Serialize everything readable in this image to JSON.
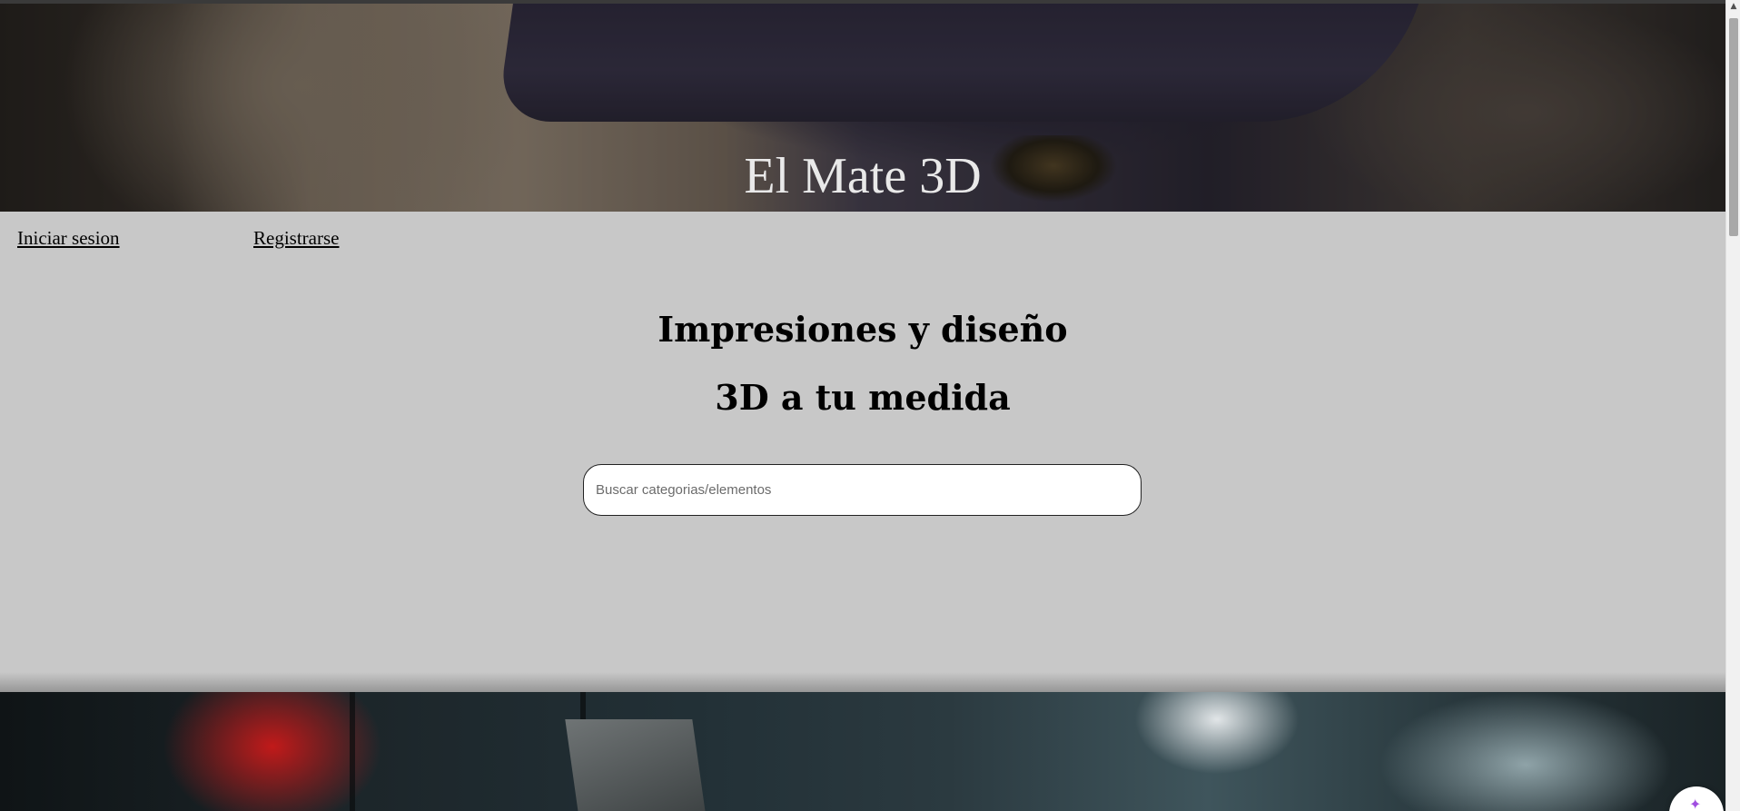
{
  "hero": {
    "title": "El Mate 3D"
  },
  "auth": {
    "login_label": "Iniciar sesion",
    "register_label": "Registrarse"
  },
  "headline": {
    "line1": "Impresiones y diseño",
    "line2": "3D a tu medida"
  },
  "search": {
    "placeholder": "Buscar categorias/elementos",
    "value": ""
  },
  "icons": {
    "scroll_up": "scroll-up-arrow-icon",
    "chat_widget": "chat-widget-icon"
  }
}
